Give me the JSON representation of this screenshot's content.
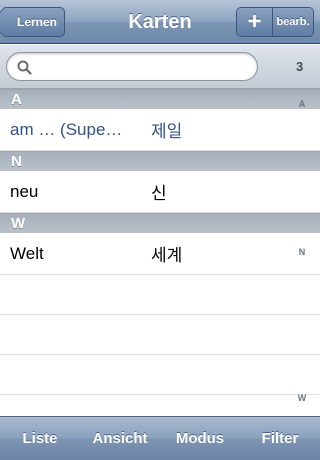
{
  "navbar": {
    "back_label": "Lernen",
    "title": "Karten",
    "add_label": "+",
    "edit_label": "bearb."
  },
  "search": {
    "placeholder": "",
    "value": "",
    "count": "3"
  },
  "sections": [
    {
      "header": "A",
      "rows": [
        {
          "term": "am … (Supe…",
          "translation": "제일",
          "selected": true
        }
      ]
    },
    {
      "header": "N",
      "rows": [
        {
          "term": "neu",
          "translation": "신",
          "selected": false
        }
      ]
    },
    {
      "header": "W",
      "rows": [
        {
          "term": "Welt",
          "translation": "세계",
          "selected": false
        }
      ]
    }
  ],
  "index": [
    "A",
    "N",
    "W"
  ],
  "tabbar": [
    "Liste",
    "Ansicht",
    "Modus",
    "Filter"
  ],
  "colors": {
    "bar_blue": "#7e96b5",
    "selected_text": "#34508a",
    "section_gray": "#b0b8c2"
  }
}
